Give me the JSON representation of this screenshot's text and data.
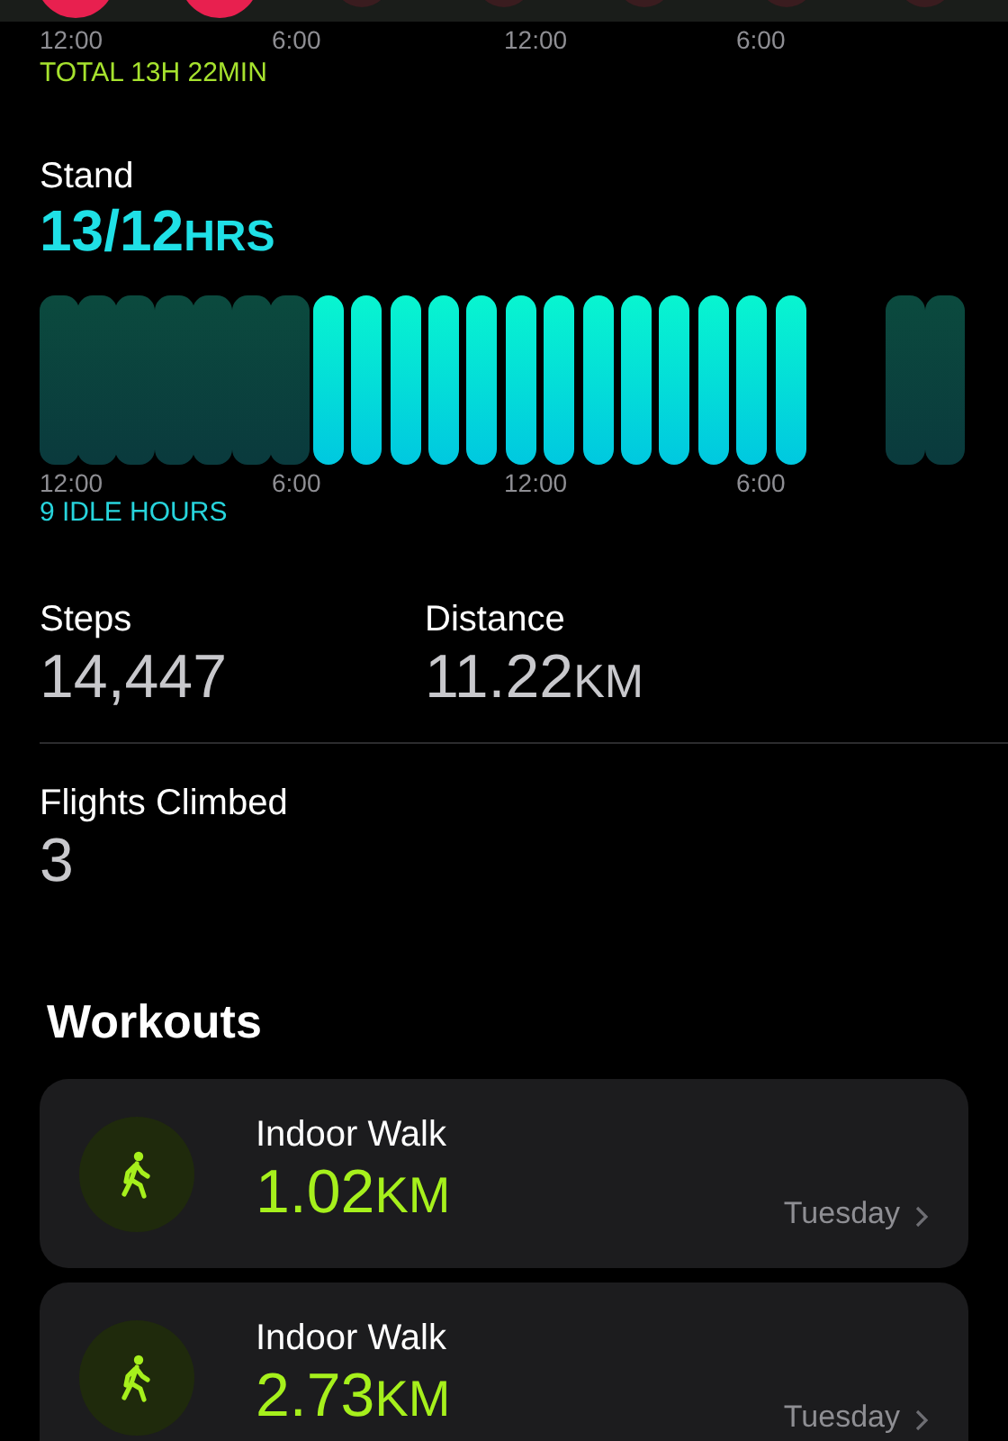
{
  "exercise": {
    "axis_labels": [
      "12:00",
      "6:00",
      "12:00",
      "6:00"
    ],
    "total": "TOTAL 13H 22MIN"
  },
  "stand": {
    "title": "Stand",
    "value": "13/12",
    "unit": "HRS",
    "hours": [
      {
        "kind": "idle"
      },
      {
        "kind": "idle"
      },
      {
        "kind": "idle"
      },
      {
        "kind": "idle"
      },
      {
        "kind": "idle"
      },
      {
        "kind": "idle"
      },
      {
        "kind": "idle"
      },
      {
        "kind": "active"
      },
      {
        "kind": "active"
      },
      {
        "kind": "active"
      },
      {
        "kind": "active"
      },
      {
        "kind": "active"
      },
      {
        "kind": "active"
      },
      {
        "kind": "active"
      },
      {
        "kind": "active"
      },
      {
        "kind": "active"
      },
      {
        "kind": "active"
      },
      {
        "kind": "active"
      },
      {
        "kind": "active"
      },
      {
        "kind": "active"
      },
      {
        "kind": "none"
      },
      {
        "kind": "none"
      },
      {
        "kind": "idle"
      },
      {
        "kind": "idle"
      }
    ],
    "axis_labels": [
      "12:00",
      "6:00",
      "12:00",
      "6:00"
    ],
    "summary": "9 IDLE HOURS"
  },
  "stats": [
    {
      "label": "Steps",
      "value": "14,447"
    },
    {
      "label": "Distance",
      "value": "11.22",
      "unit": "KM"
    }
  ],
  "flights": {
    "label": "Flights Climbed",
    "value": "3"
  },
  "workouts": {
    "title": "Workouts",
    "items": [
      {
        "name": "Indoor Walk",
        "value": "1.02",
        "unit": "KM",
        "day": "Tuesday"
      },
      {
        "name": "Indoor Walk",
        "value": "2.73",
        "unit": "KM",
        "day": "Tuesday"
      }
    ]
  }
}
